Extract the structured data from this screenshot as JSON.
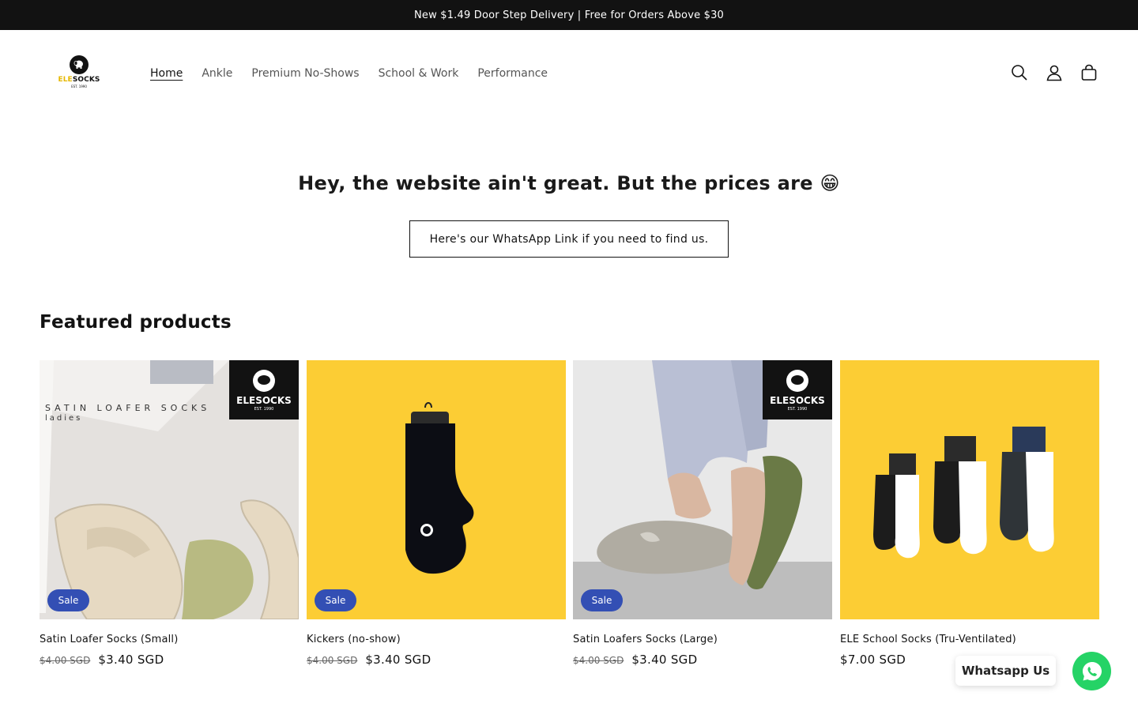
{
  "announcement": {
    "text": "New $1.49 Door Step Delivery | Free for Orders Above $30"
  },
  "header": {
    "logo": {
      "word_left": "ELE",
      "word_right": "SOCKS",
      "est": "EST. 1990"
    },
    "nav": [
      "Home",
      "Ankle",
      "Premium No-Shows",
      "School & Work",
      "Performance"
    ],
    "active_nav": "Home",
    "icons": [
      "search-icon",
      "account-icon",
      "cart-icon"
    ]
  },
  "hero": {
    "title": "Hey, the website ain't great. But the prices are 😁",
    "button_label": "Here's our WhatsApp Link if you need to find us."
  },
  "featured": {
    "title": "Featured products",
    "products": [
      {
        "title": "Satin Loafer Socks (Small)",
        "compare_price": "$4.00 SGD",
        "price": "$3.40 SGD",
        "badge": "Sale",
        "image_text": "SATIN LOAFER SOCKS",
        "image_subtext": "ladies",
        "brand_tag": "ELESOCKS",
        "brand_est": "EST. 1990"
      },
      {
        "title": "Kickers (no-show)",
        "compare_price": "$4.00 SGD",
        "price": "$3.40 SGD",
        "badge": "Sale"
      },
      {
        "title": "Satin Loafers Socks (Large)",
        "compare_price": "$4.00 SGD",
        "price": "$3.40 SGD",
        "badge": "Sale",
        "brand_tag": "ELESOCKS",
        "brand_est": "EST. 1990"
      },
      {
        "title": "ELE School Socks (Tru-Ventilated)",
        "compare_price": "",
        "price": "$7.00 SGD",
        "badge": ""
      }
    ]
  },
  "whatsapp": {
    "label": "Whatsapp Us",
    "icon": "whatsapp-icon"
  },
  "colors": {
    "announcement_bg": "#121212",
    "badge": "#334fb4",
    "product_yellow": "#fccd34",
    "whatsapp": "#25d366"
  }
}
